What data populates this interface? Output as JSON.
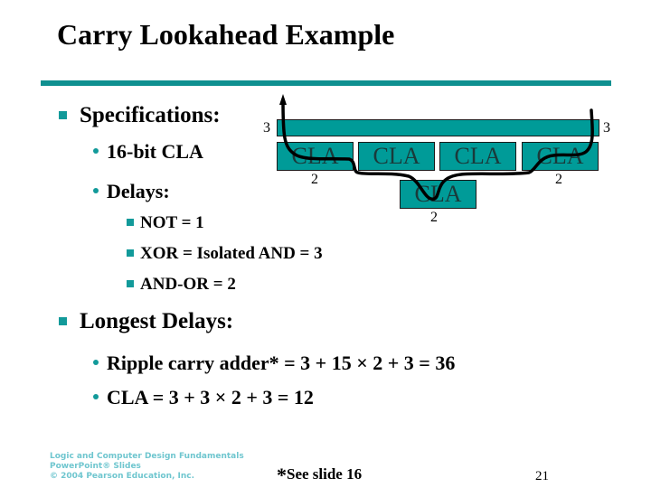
{
  "slide": {
    "title": "Carry Lookahead Example",
    "accent_color": "#129a9a",
    "page_number": "21"
  },
  "specs": {
    "heading": "Specifications:",
    "items": [
      {
        "label": "16-bit CLA"
      },
      {
        "label": "Delays:"
      }
    ],
    "delays": [
      {
        "label": "NOT = 1"
      },
      {
        "label": "XOR = Isolated AND = 3"
      },
      {
        "label": "AND-OR = 2"
      }
    ]
  },
  "diagram": {
    "top_bar_left_delay": "3",
    "top_bar_right_delay": "3",
    "cla_blocks": [
      {
        "label": "CLA",
        "delay": "2"
      },
      {
        "label": "CLA",
        "delay": ""
      },
      {
        "label": "CLA",
        "delay": ""
      },
      {
        "label": "CLA",
        "delay": "2"
      }
    ],
    "second_level_cla": {
      "label": "CLA",
      "delay": "2"
    },
    "icons": {
      "critical_path": "arrow-path-icon"
    }
  },
  "longest": {
    "heading": "Longest Delays:",
    "items": [
      {
        "label": "Ripple carry adder* = 3 + 15 × 2 + 3 = 36"
      },
      {
        "label": "CLA = 3 + 3 × 2 + 3 = 12"
      }
    ]
  },
  "footer": {
    "footnote_star": "*",
    "footnote_text": "See slide 16",
    "publisher_lines": [
      "Logic and Computer Design Fundamentals",
      "PowerPoint® Slides",
      "© 2004 Pearson Education, Inc."
    ]
  }
}
